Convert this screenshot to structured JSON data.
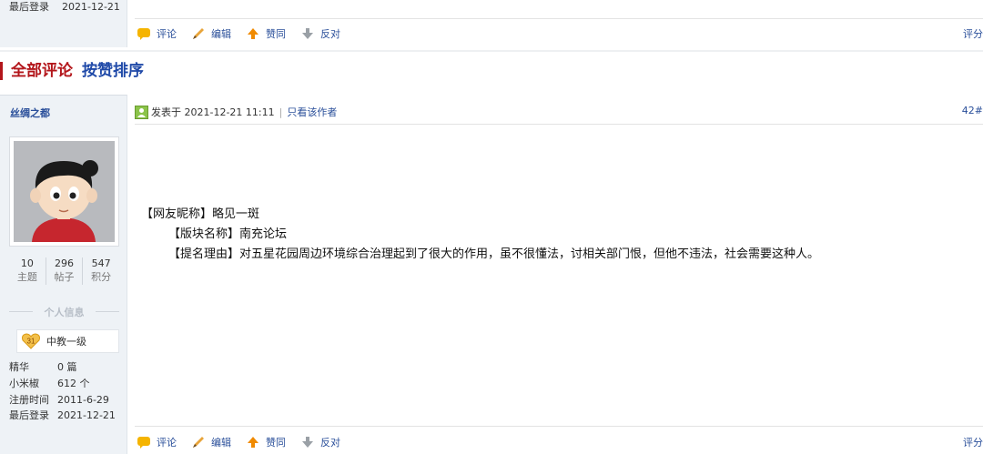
{
  "prev_post": {
    "last_login_label": "最后登录",
    "last_login_value": "2021-12-21"
  },
  "actions": {
    "comment": "评论",
    "edit": "编辑",
    "like": "赞同",
    "oppose": "反对",
    "rate": "评分"
  },
  "section": {
    "all_comments": "全部评论",
    "sort_by_likes": "按赞排序"
  },
  "user": {
    "name": "丝绸之都",
    "stats": [
      {
        "value": "10",
        "label": "主题"
      },
      {
        "value": "296",
        "label": "帖子"
      },
      {
        "value": "547",
        "label": "积分"
      }
    ],
    "personal_info_title": "个人信息",
    "level_badge": "31",
    "level_name": "中教一级",
    "profile": [
      {
        "key": "精华",
        "value": "0 篇"
      },
      {
        "key": "小米椒",
        "value": "612 个"
      },
      {
        "key": "注册时间",
        "value": "2011-6-29"
      },
      {
        "key": "最后登录",
        "value": "2021-12-21"
      }
    ]
  },
  "post": {
    "posted_at": "发表于 2021-12-21 11:11",
    "divider": "|",
    "only_author": "只看该作者",
    "floor": "42#",
    "lines": [
      "【网友昵称】略见一斑",
      "【版块名称】南充论坛",
      "【提名理由】对五星花园周边环境综合治理起到了很大的作用，虽不很懂法，讨相关部门恨，但他不违法，社会需要这种人。"
    ]
  },
  "colors": {
    "accent_red": "#b3161b",
    "link_blue": "#2a4f9a",
    "sidebar_bg": "#eef2f6"
  }
}
